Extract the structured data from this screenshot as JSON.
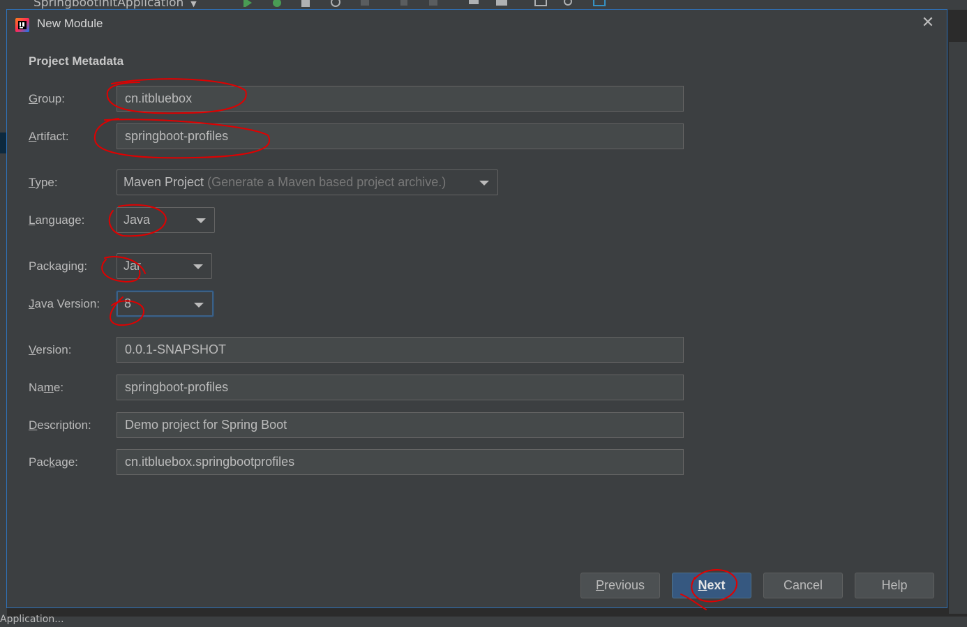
{
  "ide": {
    "run_config": "SpringbootInitApplication",
    "bottom_text": "Application..."
  },
  "dialog": {
    "title": "New Module",
    "section_title": "Project Metadata",
    "close_icon": "close-icon"
  },
  "fields": {
    "group": {
      "mnemonic": "G",
      "label_rest": "roup:",
      "value": "cn.itbluebox"
    },
    "artifact": {
      "mnemonic": "A",
      "label_rest": "rtifact:",
      "value": "springboot-profiles"
    },
    "type": {
      "mnemonic": "T",
      "label_rest": "ype:",
      "value": "Maven Project",
      "hint": "(Generate a Maven based project archive.)"
    },
    "language": {
      "mnemonic": "L",
      "label_rest": "anguage:",
      "value": "Java"
    },
    "packaging": {
      "label_pre": "Packa",
      "mnemonic": "g",
      "label_rest": "ing:",
      "value": "Jar"
    },
    "java_version": {
      "mnemonic": "J",
      "label_rest": "ava Version:",
      "value": "8"
    },
    "version": {
      "mnemonic": "V",
      "label_rest": "ersion:",
      "value": "0.0.1-SNAPSHOT"
    },
    "name": {
      "label_pre": "Na",
      "mnemonic": "m",
      "label_rest": "e:",
      "value": "springboot-profiles"
    },
    "description": {
      "mnemonic": "D",
      "label_rest": "escription:",
      "value": "Demo project for Spring Boot"
    },
    "package": {
      "label_pre": "Pac",
      "mnemonic": "k",
      "label_rest": "age:",
      "value": "cn.itbluebox.springbootprofiles"
    }
  },
  "buttons": {
    "previous": {
      "mnemonic": "P",
      "rest": "revious"
    },
    "next": {
      "mnemonic": "N",
      "rest": "ext"
    },
    "cancel": "Cancel",
    "help": "Help"
  },
  "colors": {
    "dialog_bg": "#3c3f41",
    "field_bg": "#45494a",
    "primary_button": "#365880",
    "focus_border": "#3d6185",
    "annotation_red": "#e00000"
  }
}
